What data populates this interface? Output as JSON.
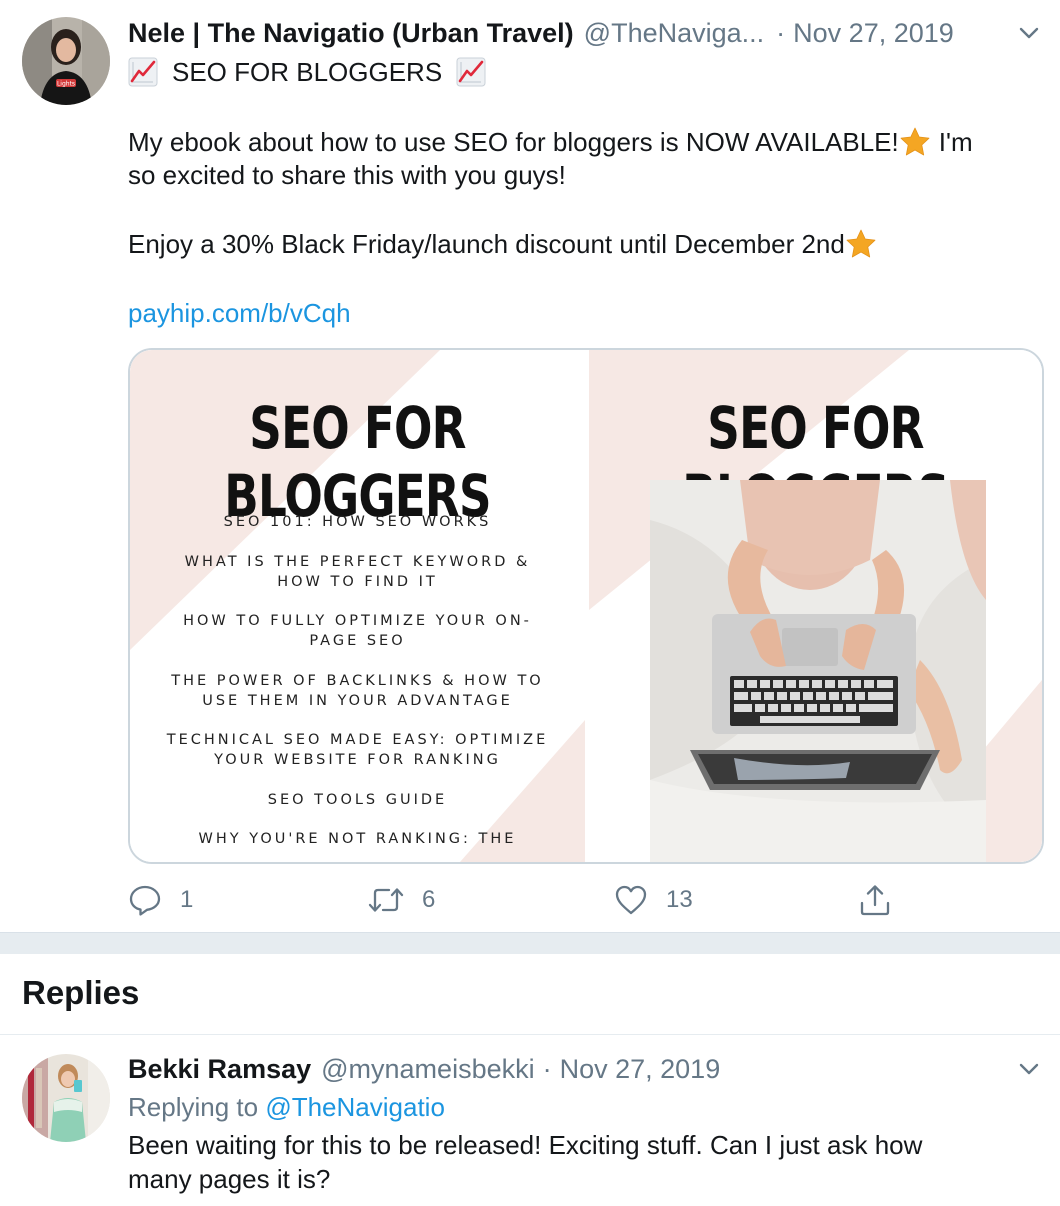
{
  "tweet": {
    "display_name": "Nele | The Navigatio (Urban Travel)",
    "handle": "@TheNaviga...",
    "separator": "·",
    "date": "Nov 27, 2019",
    "headline": "SEO FOR BLOGGERS",
    "body_line1": "My ebook about how to use SEO for bloggers is NOW AVAILABLE!",
    "body_line1_tail": "I'm",
    "body_line2": "so excited to share this with you guys!",
    "body_line3": "Enjoy a 30% Black Friday/launch discount until December 2nd",
    "link": "payhip.com/b/vCqh",
    "avatar_shirt_text": "Lights",
    "emoji": {
      "headline": "chart-increasing-icon",
      "star": "star-icon"
    }
  },
  "media": {
    "left_title": "SEO FOR BLOGGERS",
    "right_title": "SEO FOR BLOGGERS",
    "toc": [
      "SEO 101: HOW SEO WORKS",
      "WHAT IS THE PERFECT KEYWORD & HOW TO FIND IT",
      "HOW TO FULLY OPTIMIZE YOUR ON-PAGE SEO",
      "THE POWER OF BACKLINKS & HOW TO USE THEM IN YOUR ADVANTAGE",
      "TECHNICAL SEO MADE EASY: OPTIMIZE YOUR WEBSITE FOR RANKING",
      "SEO TOOLS GUIDE",
      "WHY YOU'RE NOT RANKING: THE"
    ],
    "colors": {
      "pink": "#f6e8e4",
      "dark_text": "#111111"
    }
  },
  "actions": {
    "reply_count": "1",
    "retweet_count": "6",
    "like_count": "13"
  },
  "replies": {
    "title": "Replies",
    "items": [
      {
        "display_name": "Bekki Ramsay",
        "handle": "@mynameisbekki",
        "separator": "·",
        "date": "Nov 27, 2019",
        "replying_label": "Replying to",
        "replying_to": "@TheNavigatio",
        "text_line1": "Been waiting for this to be released! Exciting stuff. Can I just ask how",
        "text_line2": "many pages it is?"
      }
    ]
  },
  "colors": {
    "link": "#1b95e0",
    "secondary_text": "#657786",
    "primary_text": "#14171a",
    "divider": "#e6ecf0",
    "star": "#f4a623"
  }
}
